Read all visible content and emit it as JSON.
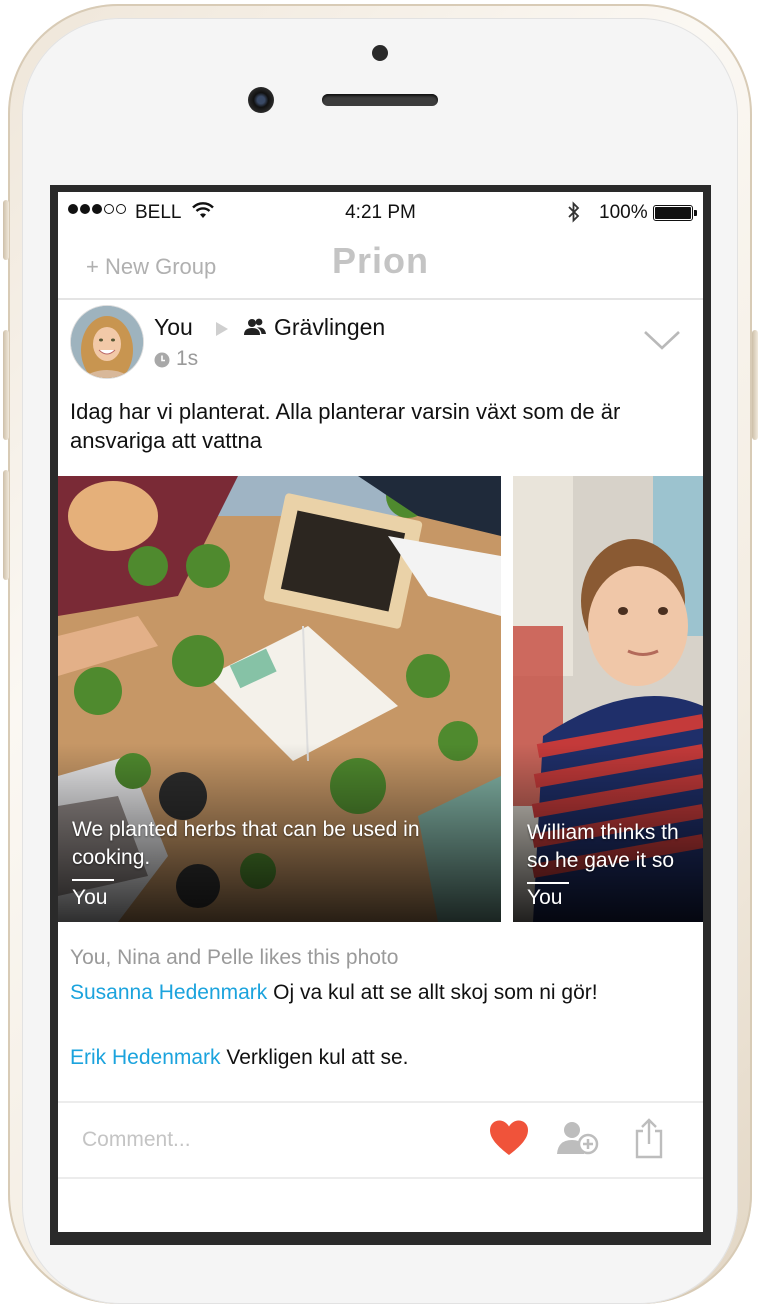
{
  "status_bar": {
    "carrier": "BELL",
    "time": "4:21 PM",
    "battery": "100%",
    "signal_bars_filled": 3,
    "signal_bars_total": 5
  },
  "nav": {
    "left_action": "+ New Group",
    "title": "Prion"
  },
  "post": {
    "author": "You",
    "group": "Grävlingen",
    "age": "1s",
    "text": "Idag har vi planterat. Alla planterar varsin växt som de är ansvariga att vattna",
    "photos": [
      {
        "caption": "We planted herbs that can be used in cooking.",
        "author": "You"
      },
      {
        "caption": "William thinks th so he gave it so",
        "author": "You"
      }
    ],
    "likes": "You, Nina and Pelle likes this photo",
    "comments": [
      {
        "name": "Susanna Hedenmark",
        "text": " Oj va kul att se allt skoj som ni gör!"
      },
      {
        "name": "Erik Hedenmark",
        "text": " Verkligen kul att se."
      }
    ]
  },
  "composer": {
    "placeholder": "Comment..."
  },
  "colors": {
    "accent_blue": "#1ba3dd",
    "heart_red": "#f0533a",
    "muted_gray": "#9a9a9a"
  },
  "icons": [
    "wifi-icon",
    "bluetooth-icon",
    "battery-icon",
    "group-icon",
    "clock-icon",
    "chevron-down-icon",
    "heart-icon",
    "add-user-icon",
    "share-icon"
  ]
}
